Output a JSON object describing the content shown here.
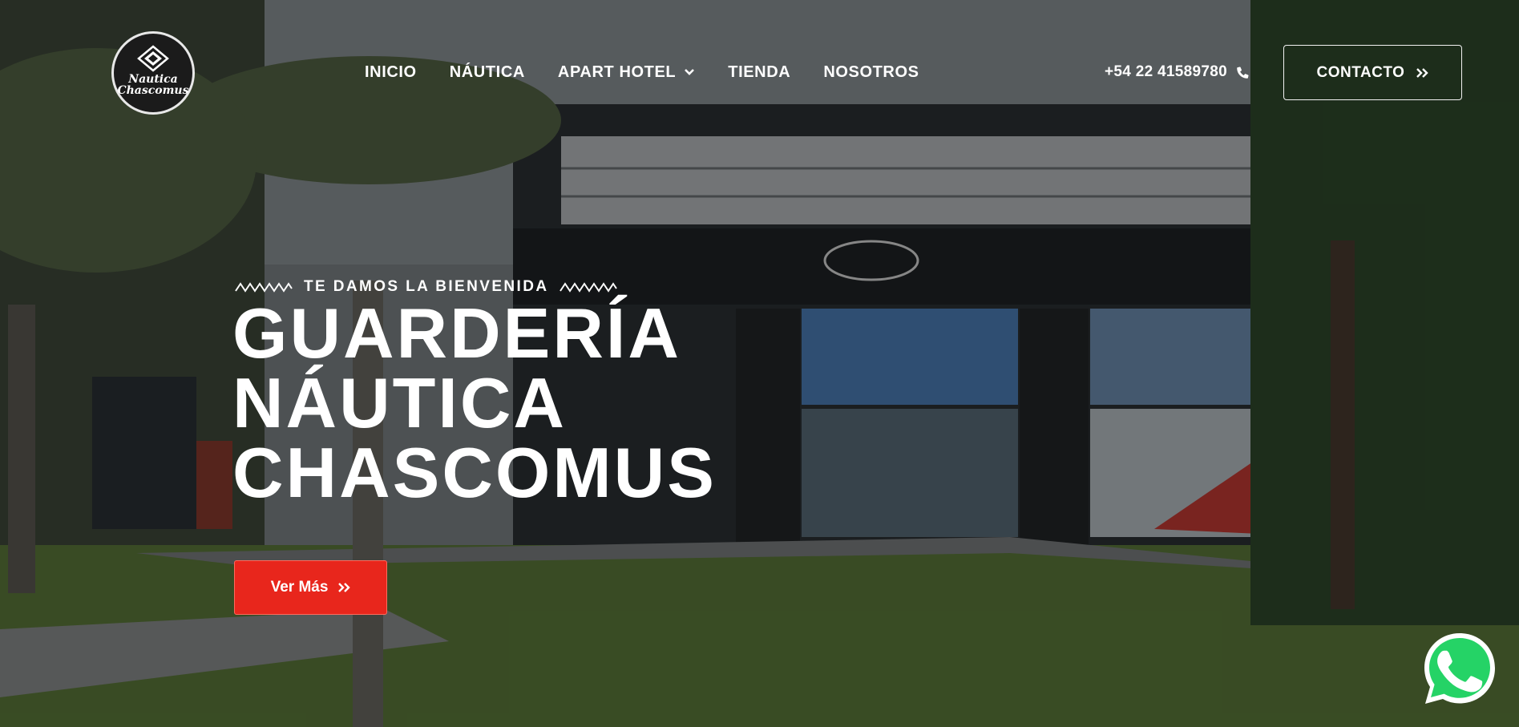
{
  "brand": {
    "logo_line1": "Nautica",
    "logo_line2": "Chascomus"
  },
  "nav": {
    "items": [
      {
        "label": "INICIO"
      },
      {
        "label": "NÁUTICA"
      },
      {
        "label": "APART HOTEL",
        "has_dropdown": true
      },
      {
        "label": "TIENDA"
      },
      {
        "label": "NOSOTROS"
      }
    ]
  },
  "header": {
    "phone": "+54 22 41589780",
    "contact_label": "CONTACTO"
  },
  "hero": {
    "eyebrow": "TE DAMOS LA BIENVENIDA",
    "title_lines": [
      "GUARDERÍA",
      "NÁUTICA",
      "CHASCOMUS"
    ],
    "cta_label": "Ver Más"
  },
  "colors": {
    "accent": "#e8261c",
    "whatsapp": "#25d366",
    "text": "#ffffff"
  },
  "icons": {
    "phone": "phone-icon",
    "contact_arrow": "double-chevron-right-icon",
    "cta_arrow": "double-chevron-right-icon",
    "dropdown": "chevron-down-icon",
    "whatsapp": "whatsapp-icon",
    "decor": "wave-icon"
  }
}
